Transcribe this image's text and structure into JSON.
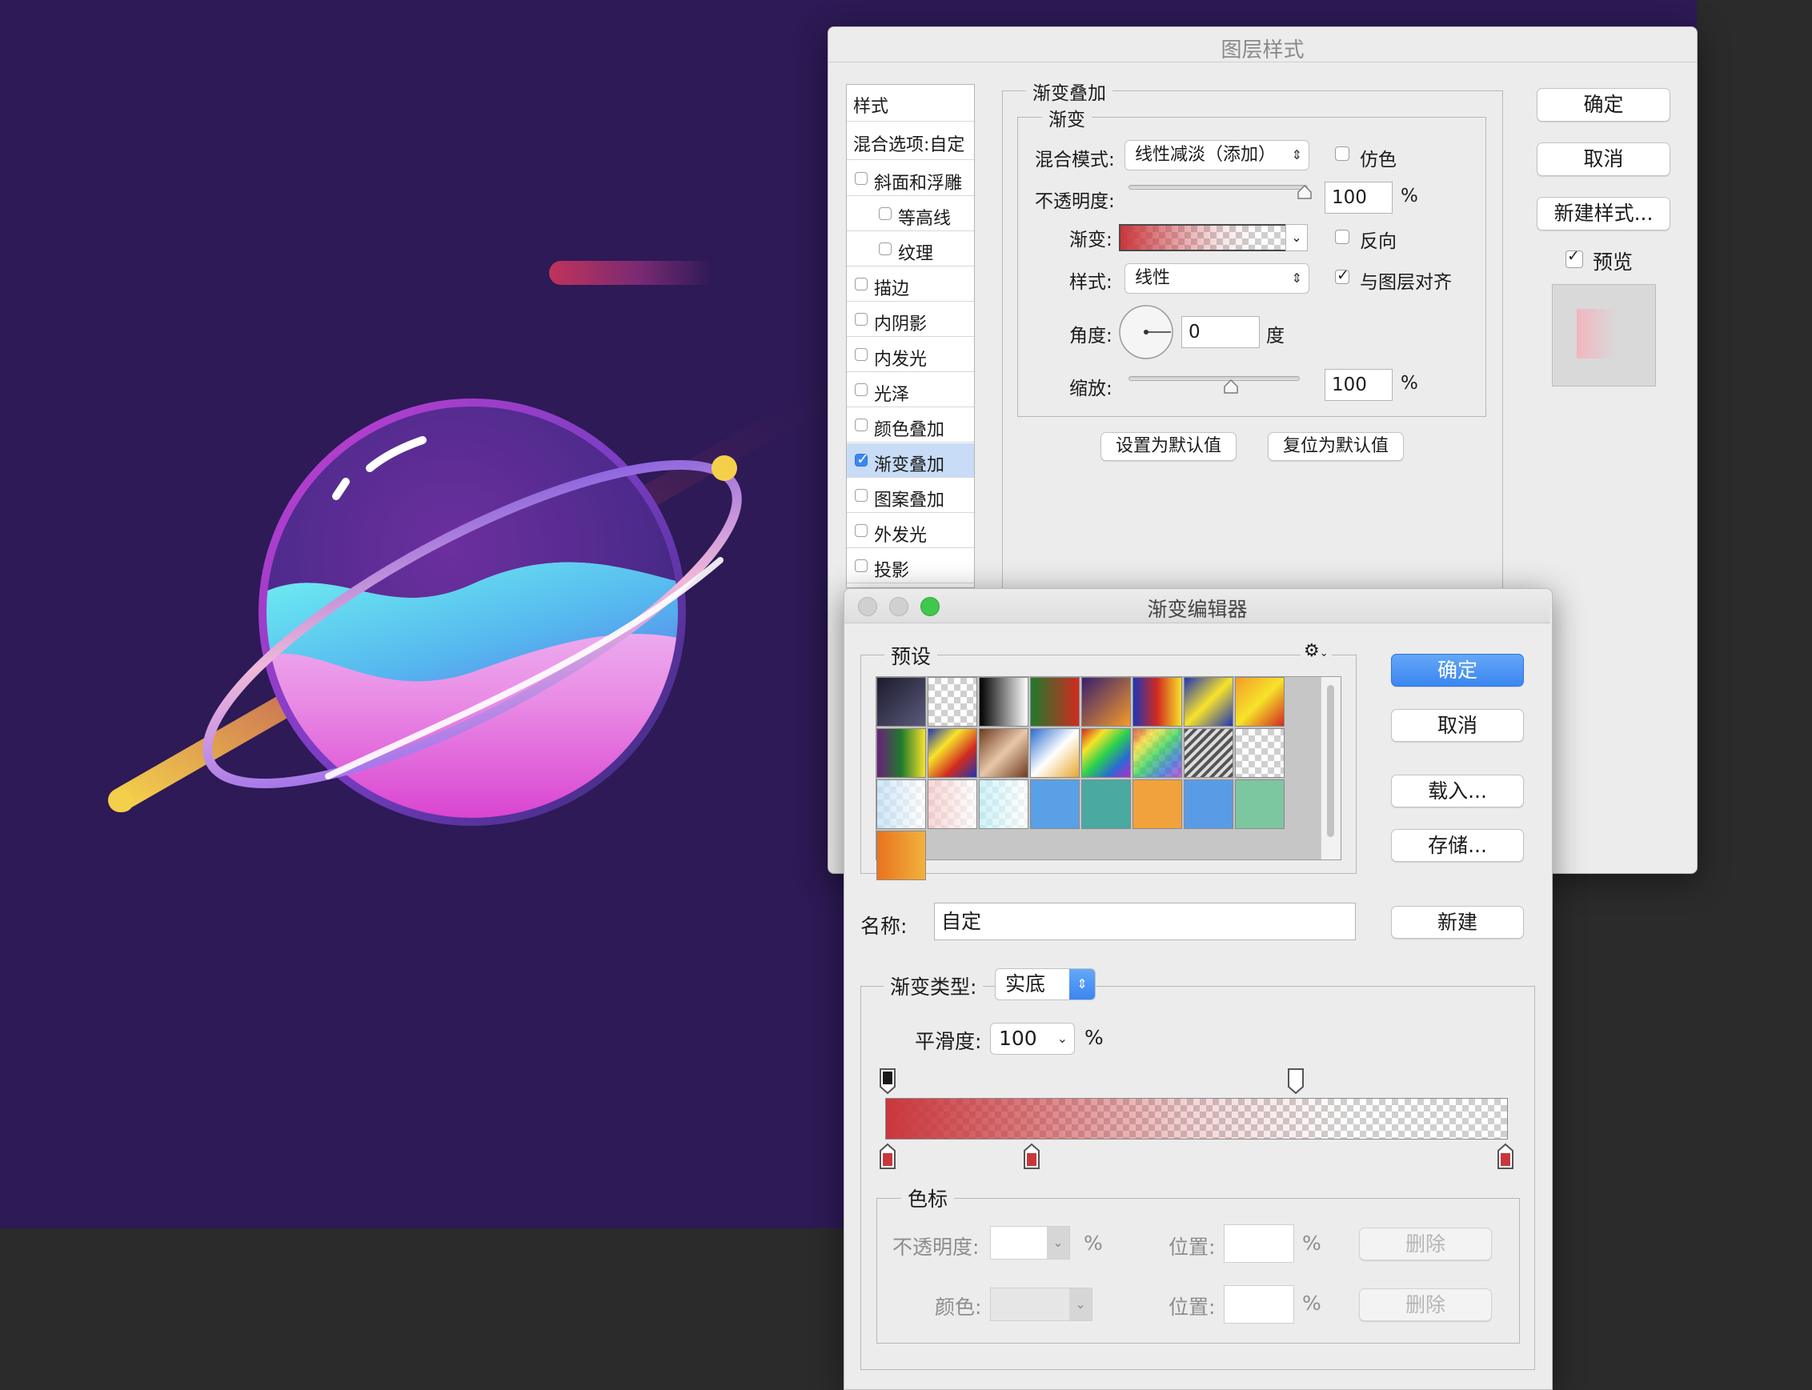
{
  "layer_style": {
    "title": "图层样式",
    "styles_header": "样式",
    "blend_options": "混合选项:自定",
    "effects": [
      {
        "label": "斜面和浮雕",
        "checked": false,
        "indent": false
      },
      {
        "label": "等高线",
        "checked": false,
        "indent": true
      },
      {
        "label": "纹理",
        "checked": false,
        "indent": true
      },
      {
        "label": "描边",
        "checked": false,
        "indent": false
      },
      {
        "label": "内阴影",
        "checked": false,
        "indent": false
      },
      {
        "label": "内发光",
        "checked": false,
        "indent": false
      },
      {
        "label": "光泽",
        "checked": false,
        "indent": false
      },
      {
        "label": "颜色叠加",
        "checked": false,
        "indent": false
      },
      {
        "label": "渐变叠加",
        "checked": true,
        "indent": false,
        "selected": true
      },
      {
        "label": "图案叠加",
        "checked": false,
        "indent": false
      },
      {
        "label": "外发光",
        "checked": false,
        "indent": false
      },
      {
        "label": "投影",
        "checked": false,
        "indent": false
      }
    ],
    "group_title": "渐变叠加",
    "sub_group_title": "渐变",
    "blend_mode_label": "混合模式:",
    "blend_mode_value": "线性减淡（添加）",
    "dither_label": "仿色",
    "dither_checked": false,
    "opacity_label": "不透明度:",
    "opacity_value": "100",
    "percent": "%",
    "gradient_label": "渐变:",
    "reverse_label": "反向",
    "reverse_checked": false,
    "style_label": "样式:",
    "style_value": "线性",
    "align_label": "与图层对齐",
    "align_checked": true,
    "angle_label": "角度:",
    "angle_value": "0",
    "degree_unit": "度",
    "scale_label": "缩放:",
    "scale_value": "100",
    "opacity_slider_fraction": 1.0,
    "scale_slider_fraction": 0.6,
    "set_default": "设置为默认值",
    "reset_default": "复位为默认值",
    "ok": "确定",
    "cancel": "取消",
    "new_style": "新建样式...",
    "preview_label": "预览",
    "preview_checked": true
  },
  "gradient_editor": {
    "title": "渐变编辑器",
    "presets_label": "预设",
    "gear_icon": "gear-icon",
    "ok": "确定",
    "cancel": "取消",
    "load": "载入...",
    "save": "存储...",
    "name_label": "名称:",
    "name_value": "自定",
    "new_button": "新建",
    "type_label": "渐变类型:",
    "type_value": "实底",
    "smoothness_label": "平滑度:",
    "smoothness_value": "100",
    "percent": "%",
    "stops_group": "色标",
    "stop_opacity_label": "不透明度:",
    "stop_color_label": "颜色:",
    "position_label": "位置:",
    "delete_label": "删除",
    "gradient_color": "#c9373c",
    "preset_count": 25,
    "preset_swatches": [
      "linear-gradient(135deg,#1c1b2e,#5a5a7a)",
      "checker-gray",
      "linear-gradient(90deg,#000,#fff)",
      "linear-gradient(90deg,#1f7a2c,#d12a1f)",
      "linear-gradient(135deg,#3a1f6e,#f39b2a)",
      "linear-gradient(90deg,#1f35b5,#d12a1f,#f7e32a)",
      "linear-gradient(135deg,#1f35b5,#f7e32a,#1f35b5)",
      "linear-gradient(135deg,#f39b2a,#f7e32a,#d12a1f)",
      "linear-gradient(90deg,#6a1f7a,#1f7a2c,#f7e32a)",
      "linear-gradient(135deg,#1f35b5,#f7e32a,#d12a1f,#1f35b5)",
      "linear-gradient(135deg,#6e3a1f,#e8c7a8,#6e3a1f)",
      "linear-gradient(135deg,#2a6cd1,#fff,#e8a52a)",
      "linear-gradient(135deg,#d12a1f,#f7e32a,#2ad14e,#2a6cd1,#b52ad1)",
      "linear-gradient(135deg,#d12a1f,#f7e32a,#2ad14e,#2a6cd1,#b52ad1) checker",
      "repeating-linear-gradient(135deg,#555 0,#555 4px,#ddd 4px,#ddd 8px)",
      "checker-gray",
      "linear-gradient(90deg,#bfe0f7,#fff) checker",
      "linear-gradient(90deg,#f7c9c9,#fff) checker",
      "linear-gradient(90deg,#bff0f7,#fff) checker",
      "linear-gradient(90deg,#5aa0e6,#5aa0e6)",
      "linear-gradient(90deg,#4aa9a0,#4aa9a0)",
      "linear-gradient(90deg,#f2a23c,#f2a23c)",
      "linear-gradient(90deg,#5a9be6,#5a9be6)",
      "linear-gradient(90deg,#7cc7a0,#7cc7a0)",
      "linear-gradient(90deg,#e8731f,#f2b23c)"
    ]
  }
}
